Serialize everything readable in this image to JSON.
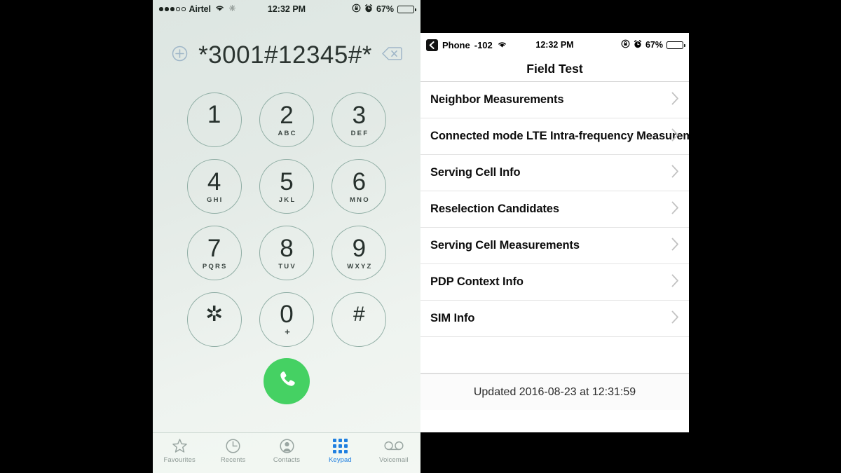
{
  "left_phone": {
    "status_bar": {
      "signal_dots_filled": 3,
      "signal_dots_empty": 2,
      "carrier": "Airtel",
      "wifi_icon": "wifi-icon",
      "bluetooth_icon": "location-icon",
      "time": "12:32 PM",
      "rotation_lock_icon": "rotation-lock-icon",
      "alarm_icon": "alarm-icon",
      "battery_percent": "67%",
      "battery_level": 67
    },
    "dialer": {
      "add_contact_icon": "add-contact-icon",
      "number": "*3001#12345#*",
      "backspace_icon": "backspace-icon"
    },
    "keys": [
      {
        "digit": "1",
        "letters": ""
      },
      {
        "digit": "2",
        "letters": "ABC"
      },
      {
        "digit": "3",
        "letters": "DEF"
      },
      {
        "digit": "4",
        "letters": "GHI"
      },
      {
        "digit": "5",
        "letters": "JKL"
      },
      {
        "digit": "6",
        "letters": "MNO"
      },
      {
        "digit": "7",
        "letters": "PQRS"
      },
      {
        "digit": "8",
        "letters": "TUV"
      },
      {
        "digit": "9",
        "letters": "WXYZ"
      },
      {
        "digit": "✲",
        "letters": ""
      },
      {
        "digit": "0",
        "letters": "+"
      },
      {
        "digit": "#",
        "letters": ""
      }
    ],
    "call_button": {
      "icon": "phone-call-icon",
      "color": "#45d163"
    },
    "tabs": [
      {
        "label": "Favourites",
        "icon": "star-icon",
        "active": false
      },
      {
        "label": "Recents",
        "icon": "clock-icon",
        "active": false
      },
      {
        "label": "Contacts",
        "icon": "person-icon",
        "active": false
      },
      {
        "label": "Keypad",
        "icon": "keypad-grid-icon",
        "active": true
      },
      {
        "label": "Voicemail",
        "icon": "voicemail-icon",
        "active": false
      }
    ],
    "active_tab_color": "#1f7fe0"
  },
  "right_phone": {
    "status_bar": {
      "back_icon": "back-chevron-icon",
      "back_label": "Phone",
      "signal_dbm": "-102",
      "wifi_icon": "wifi-icon",
      "time": "12:32 PM",
      "rotation_lock_icon": "rotation-lock-icon",
      "alarm_icon": "alarm-icon",
      "battery_percent": "67%",
      "battery_level": 67
    },
    "nav_title": "Field Test",
    "rows": [
      {
        "label": "Neighbor Measurements",
        "chevron": true
      },
      {
        "label": "Connected mode LTE Intra-frequency Measurements",
        "chevron": true
      },
      {
        "label": "Serving Cell Info",
        "chevron": true
      },
      {
        "label": "Reselection Candidates",
        "chevron": true
      },
      {
        "label": "Serving Cell Measurements",
        "chevron": true
      },
      {
        "label": "PDP Context Info",
        "chevron": true
      },
      {
        "label": "SIM Info",
        "chevron": true
      }
    ],
    "footer_text": "Updated 2016-08-23 at 12:31:59"
  }
}
